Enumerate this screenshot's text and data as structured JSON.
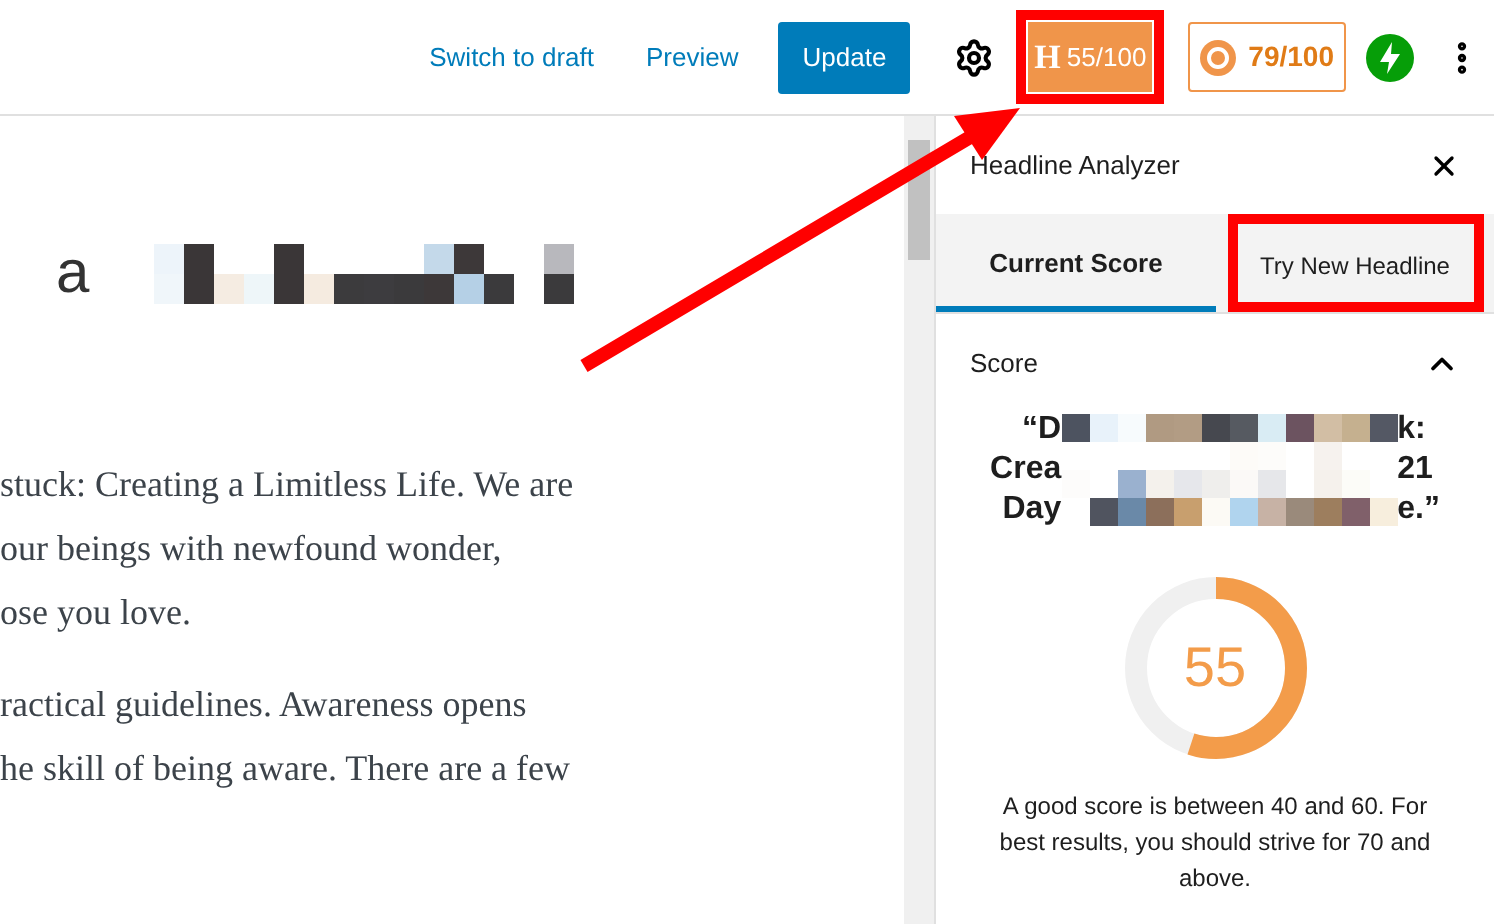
{
  "toolbar": {
    "switch_to_draft": "Switch to draft",
    "preview": "Preview",
    "update": "Update",
    "headline_badge": {
      "logo_letter": "H",
      "score": "55/100"
    },
    "seo_badge": {
      "score": "79/100"
    }
  },
  "editor": {
    "title_fragment": "a",
    "paragraphs": [
      [
        "stuck: Creating a Limitless Life. We are",
        "our beings with newfound wonder,",
        "ose you love."
      ],
      [
        "ractical guidelines. Awareness opens",
        "he skill of being aware. There are a few"
      ]
    ]
  },
  "sidebar": {
    "title": "Headline Analyzer",
    "tabs": [
      {
        "label": "Current Score",
        "selected": true
      },
      {
        "label": "Try New Headline",
        "selected": false
      }
    ],
    "score_panel": {
      "heading": "Score",
      "expanded": true,
      "headline_lines": [
        {
          "start": "“D",
          "end": "k:"
        },
        {
          "start": "Crea",
          "end": "21"
        },
        {
          "start": "Day",
          "end": "e.”"
        }
      ],
      "score": "55",
      "note": "A good score is between 40 and 60. For best results, you should strive for 70 and above."
    }
  }
}
